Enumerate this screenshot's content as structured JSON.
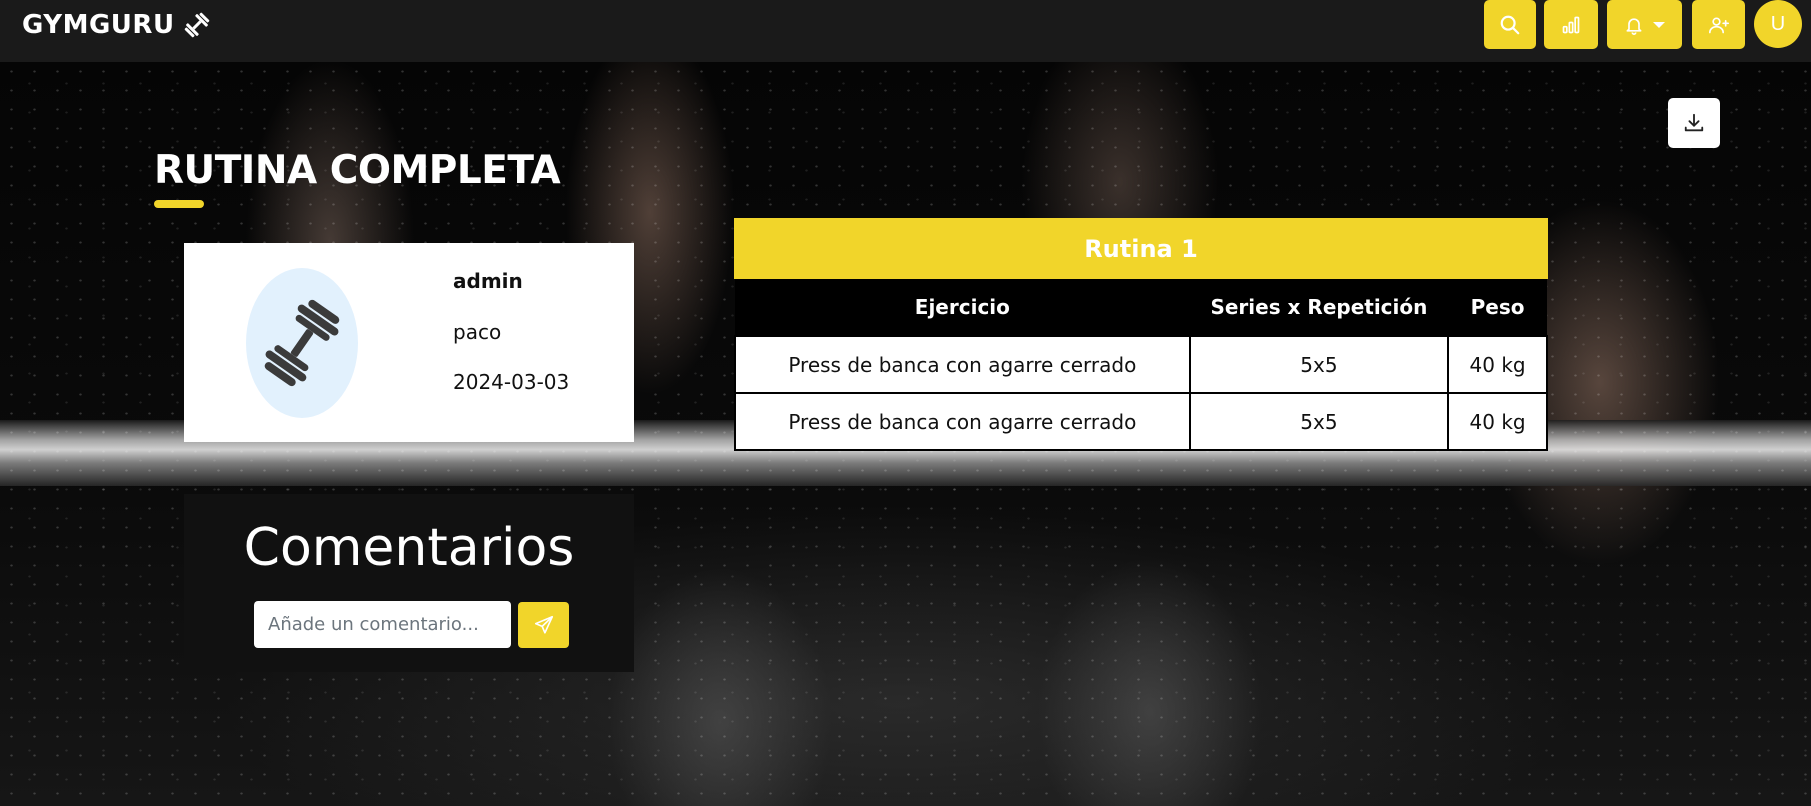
{
  "navbar": {
    "brand": "GYMGURU",
    "buttons": [
      {
        "icon": "search-icon"
      },
      {
        "icon": "chart-icon"
      },
      {
        "icon": "bell-icon"
      },
      {
        "icon": "user-plus-icon"
      }
    ],
    "avatar_initial": "U"
  },
  "page": {
    "title": "RUTINA COMPLETA"
  },
  "profile": {
    "username": "admin",
    "name": "paco",
    "date": "2024-03-03"
  },
  "comments": {
    "heading": "Comentarios",
    "placeholder": "Añade un comentario..."
  },
  "routine": {
    "title": "Rutina 1",
    "headers": [
      "Ejercicio",
      "Series x Repetición",
      "Peso"
    ],
    "rows": [
      [
        "Press de banca con agarre cerrado",
        "5x5",
        "40 kg"
      ],
      [
        "Press de banca con agarre cerrado",
        "5x5",
        "40 kg"
      ]
    ]
  },
  "colors": {
    "accent": "#f1d52a",
    "navbar": "#1a1a1a"
  }
}
